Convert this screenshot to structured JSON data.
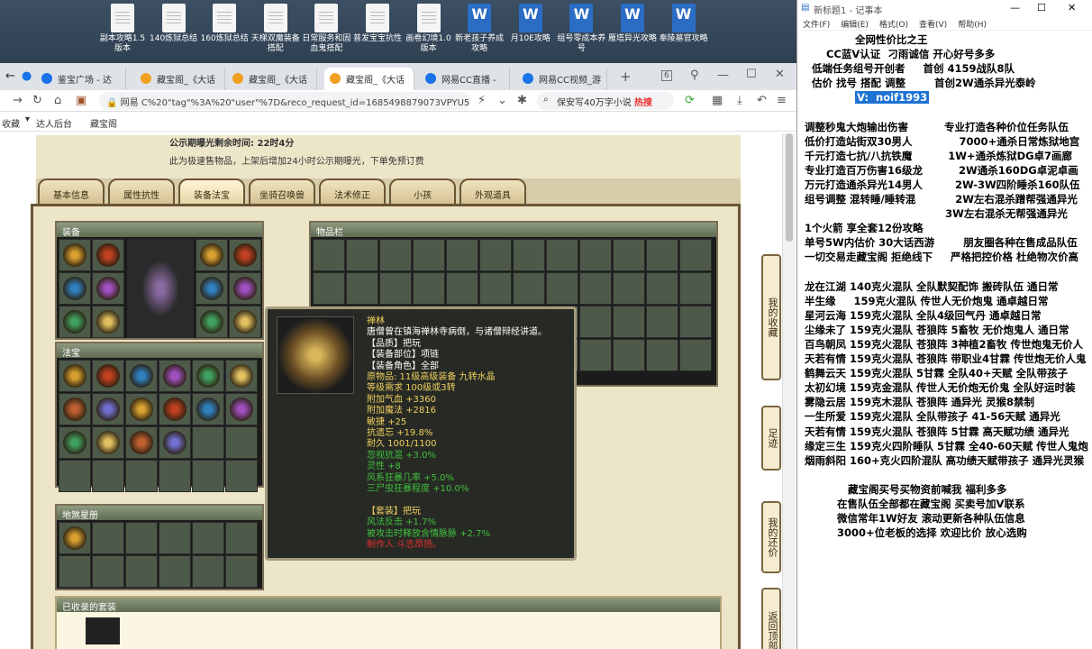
{
  "desktop": {
    "icons": [
      {
        "label": "副本攻略1.5版本",
        "type": "doc"
      },
      {
        "label": "140炼狱总结",
        "type": "doc"
      },
      {
        "label": "160炼狱总结",
        "type": "doc"
      },
      {
        "label": "天梯双魔装备搭配",
        "type": "doc"
      },
      {
        "label": "日常服务和固血鬼搭配",
        "type": "doc"
      },
      {
        "label": "普发宝宝抗性",
        "type": "doc"
      },
      {
        "label": "画卷幻境1.0版本",
        "type": "doc"
      },
      {
        "label": "新老孩子养成攻略",
        "type": "word"
      },
      {
        "label": "月10E攻略",
        "type": "word"
      },
      {
        "label": "组号零成本养号",
        "type": "word"
      },
      {
        "label": "雁塔异光攻略",
        "type": "word"
      },
      {
        "label": "奉陵墓官攻略",
        "type": "word"
      }
    ]
  },
  "browser": {
    "tabs": [
      {
        "label": "鉴宝广场 - 达"
      },
      {
        "label": "藏宝阁_《大话"
      },
      {
        "label": "藏宝阁_《大话"
      },
      {
        "label": "藏宝阁_《大话"
      },
      {
        "label": "网易CC直播 -"
      },
      {
        "label": "网易CC视频_游"
      }
    ],
    "tab_count": "6",
    "url": "网易  C%20\"tag\"%3A%20\"user\"%7D&reco_request_id=1685498879073VPYU5",
    "search": "保安写40万字小说",
    "hot": "热搜",
    "bookmarks": [
      "收藏",
      "达人后台",
      "藏宝阁"
    ]
  },
  "game": {
    "notice1": "公示期曝光剩余时间:   22时4分",
    "notice2": "此为极速售物品，上架后增加24小时公示期曝光，下单免预订费",
    "tabs": [
      "基本信息",
      "属性抗性",
      "装备法宝",
      "坐骑召唤兽",
      "法术修正",
      "小孩",
      "外观道具"
    ],
    "sections": {
      "equip": "装备",
      "fabao": "法宝",
      "inventory": "物品栏",
      "tianshu": "地煞星册",
      "collection": "已收录的套装"
    },
    "side_buttons": [
      "我的收藏",
      "足迹",
      "我的还价",
      "返回顶部"
    ],
    "tooltip": {
      "lines": [
        {
          "text": "禅林",
          "color": "#f0d060"
        },
        {
          "text": "唐僧曾在镇海禅林寺病倒，与诸僧辩经讲道。",
          "color": "#ffffff"
        },
        {
          "text": "【品质】把玩",
          "color": "#ffffff"
        },
        {
          "text": "【装备部位】项链",
          "color": "#ffffff"
        },
        {
          "text": "【装备角色】全部",
          "color": "#ffffff"
        },
        {
          "text": "原物品: 11级高级装备 九转水晶",
          "color": "#f0d060"
        },
        {
          "text": "等级需求 100级或3转",
          "color": "#f0d060"
        },
        {
          "text": "附加气血 +3360",
          "color": "#f0d060"
        },
        {
          "text": "附加魔法 +2816",
          "color": "#f0d060"
        },
        {
          "text": "敏捷 +25",
          "color": "#f0d060"
        },
        {
          "text": "抗遗忘 +19.8%",
          "color": "#f0d060"
        },
        {
          "text": "耐久 1001/1100",
          "color": "#f0d060"
        },
        {
          "text": "忽视抗混 +3.0%",
          "color": "#40c040"
        },
        {
          "text": "灵性 +8",
          "color": "#40c040"
        },
        {
          "text": "风系狂暴几率 +5.0%",
          "color": "#40c040"
        },
        {
          "text": "三尸虫狂暴程度 +10.0%",
          "color": "#40c040"
        },
        {
          "text": "",
          "color": "#ffffff"
        },
        {
          "text": "【套装】把玩",
          "color": "#f0d060"
        },
        {
          "text": "风法反击 +1.7%",
          "color": "#40c040"
        },
        {
          "text": "被攻击时释放含情脉脉 +2.7%",
          "color": "#40c040"
        },
        {
          "text": "制作人 斗志昂扬。",
          "color": "#e03030"
        }
      ]
    }
  },
  "notepad": {
    "title": "新标题1 - 记事本",
    "menu": [
      "文件(F)",
      "编辑(E)",
      "格式(O)",
      "查看(V)",
      "帮助(H)"
    ],
    "lines": [
      {
        "text": "                全网性价比之王"
      },
      {
        "text": "        CC蓝V认证  刁雨诚信 开心好号多多"
      },
      {
        "text": "    低端任务组号开创者     首创 4159战队8队"
      },
      {
        "text": "    估价 找号 搭配 调整        首创2W通杀异光泰岭"
      },
      {
        "text": "                ",
        "sel": "V:  noif1993"
      },
      {
        "text": ""
      },
      {
        "text": "  调整秒鬼大炮输出伤害          专业打造各种价位任务队伍"
      },
      {
        "text": "  低价打造站街双30男人             7000+通杀日常炼狱地宫"
      },
      {
        "text": "  千元打造七抗/八抗铁魔          1W+通杀炼狱DG卓7画廊"
      },
      {
        "text": "  专业打造百万伤害16级龙          2W通杀160DG卓泥卓画"
      },
      {
        "text": "  万元打造通杀异光14男人         2W-3W四阶睡杀160队伍"
      },
      {
        "text": "  组号调整 混转睡/睡转混           2W左右混杀蹭帮强通异光"
      },
      {
        "text": "                                         3W左右混杀无帮强通异光"
      },
      {
        "text": "  1个火箭 享全套12份攻略"
      },
      {
        "text": "  单号5W内估价 30大话西游        朋友圈各种在售成品队伍"
      },
      {
        "text": "  一切交易走藏宝阁 拒绝线下     严格把控价格 杜绝物次价高"
      },
      {
        "text": ""
      },
      {
        "text": "  龙在江湖 140克火混队 全队默契配饰 搬砖队伍 通日常"
      },
      {
        "text": "  半生缘     159克火混队 传世人无价炮鬼 通卓越日常"
      },
      {
        "text": "  星河云海 159克火混队 全队4级回气丹 通卓越日常"
      },
      {
        "text": "  尘缘未了 159克火混队 苍狼阵 5畜牧 无价炮鬼人 通日常"
      },
      {
        "text": "  百鸟朝凤 159克火混队 苍狼阵 3神植2畜牧 传世炮鬼无价人"
      },
      {
        "text": "  天若有情 159克火混队 苍狼阵 带职业4甘霖 传世炮无价人鬼"
      },
      {
        "text": "  鹤舞云天 159克火混队 5甘霖 全队40+天赋 全队带孩子"
      },
      {
        "text": "  太初幻境 159克金混队 传世人无价炮无价鬼 全队好运时装"
      },
      {
        "text": "  雾隐云居 159克木混队 苍狼阵 通异光 灵猴8禁制"
      },
      {
        "text": "  一生所爱 159克火混队 全队带孩子 41-56天赋 通异光"
      },
      {
        "text": "  天若有情 159克火混队 苍狼阵 5甘霖 高天赋功绩 通异光"
      },
      {
        "text": "  缘定三生 159克火四阶睡队 5甘霖 全40-60天赋 传世人鬼炮"
      },
      {
        "text": "  烟雨斜阳 160+克火四阶混队 高功绩天赋带孩子 通异光灵猴"
      },
      {
        "text": ""
      },
      {
        "text": "              藏宝阁买号买物资前喊我 福利多多"
      },
      {
        "text": "           在售队伍全部都在藏宝阁 买卖号加V联系"
      },
      {
        "text": "           微信常年1W好友 滚动更新各种队伍信息"
      },
      {
        "text": "           3000+位老板的选择 欢迎比价 放心选购"
      }
    ]
  }
}
